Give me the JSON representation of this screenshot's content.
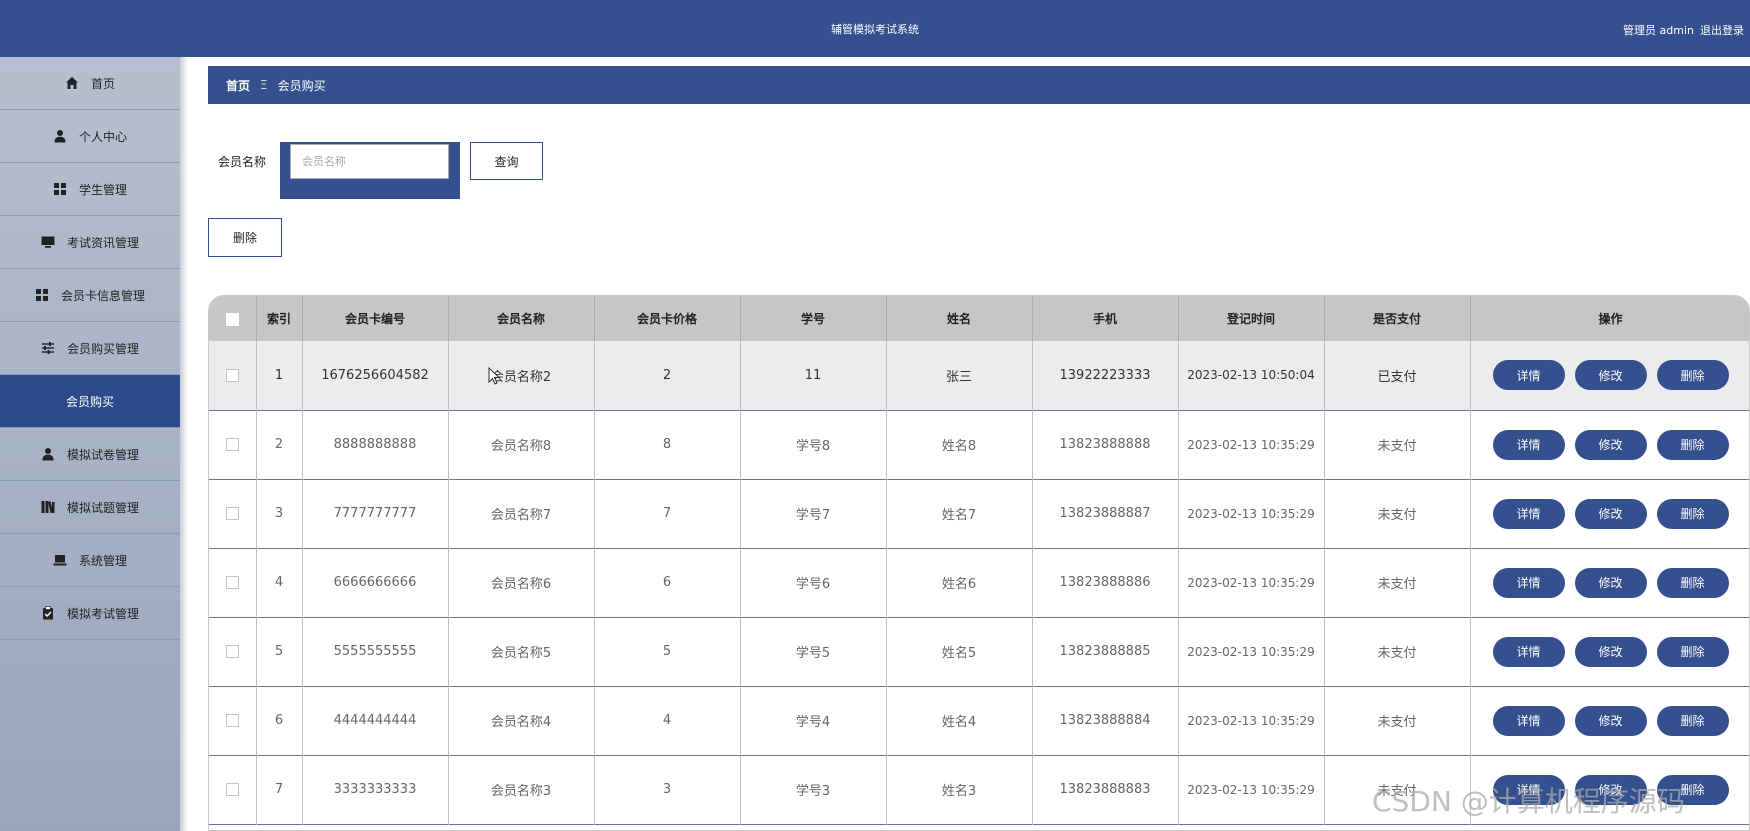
{
  "header": {
    "title": "辅管模拟考试系统",
    "user": "管理员 admin",
    "logout": "退出登录"
  },
  "sidebar": {
    "items": [
      {
        "label": "首页",
        "icon": "home-icon",
        "active": false
      },
      {
        "label": "个人中心",
        "icon": "user-icon",
        "active": false
      },
      {
        "label": "学生管理",
        "icon": "grid-icon",
        "active": false
      },
      {
        "label": "考试资讯管理",
        "icon": "monitor-icon",
        "active": false
      },
      {
        "label": "会员卡信息管理",
        "icon": "grid-icon",
        "active": false
      },
      {
        "label": "会员购买管理",
        "icon": "sliders-icon",
        "active": false
      },
      {
        "label": "会员购买",
        "icon": "",
        "active": true
      },
      {
        "label": "模拟试卷管理",
        "icon": "user-icon",
        "active": false
      },
      {
        "label": "模拟试题管理",
        "icon": "books-icon",
        "active": false
      },
      {
        "label": "系统管理",
        "icon": "laptop-icon",
        "active": false
      },
      {
        "label": "模拟考试管理",
        "icon": "clipboard-icon",
        "active": false
      }
    ]
  },
  "breadcrumb": {
    "home": "首页",
    "separator": "Ξ",
    "current": "会员购买"
  },
  "search": {
    "label": "会员名称",
    "placeholder": "会员名称",
    "value": "",
    "query_label": "查询"
  },
  "toolbar": {
    "delete_label": "删除"
  },
  "table": {
    "columns": [
      "索引",
      "会员卡编号",
      "会员名称",
      "会员卡价格",
      "学号",
      "姓名",
      "手机",
      "登记时间",
      "是否支付",
      "操作"
    ],
    "rows": [
      {
        "index": "1",
        "card_no": "1676256604582",
        "member_name": "会员名称2",
        "price": "2",
        "student_no": "11",
        "name": "张三",
        "phone": "13922223333",
        "time": "2023-02-13 10:50:04",
        "paid": "已支付"
      },
      {
        "index": "2",
        "card_no": "8888888888",
        "member_name": "会员名称8",
        "price": "8",
        "student_no": "学号8",
        "name": "姓名8",
        "phone": "13823888888",
        "time": "2023-02-13 10:35:29",
        "paid": "未支付"
      },
      {
        "index": "3",
        "card_no": "7777777777",
        "member_name": "会员名称7",
        "price": "7",
        "student_no": "学号7",
        "name": "姓名7",
        "phone": "13823888887",
        "time": "2023-02-13 10:35:29",
        "paid": "未支付"
      },
      {
        "index": "4",
        "card_no": "6666666666",
        "member_name": "会员名称6",
        "price": "6",
        "student_no": "学号6",
        "name": "姓名6",
        "phone": "13823888886",
        "time": "2023-02-13 10:35:29",
        "paid": "未支付"
      },
      {
        "index": "5",
        "card_no": "5555555555",
        "member_name": "会员名称5",
        "price": "5",
        "student_no": "学号5",
        "name": "姓名5",
        "phone": "13823888885",
        "time": "2023-02-13 10:35:29",
        "paid": "未支付"
      },
      {
        "index": "6",
        "card_no": "4444444444",
        "member_name": "会员名称4",
        "price": "4",
        "student_no": "学号4",
        "name": "姓名4",
        "phone": "13823888884",
        "time": "2023-02-13 10:35:29",
        "paid": "未支付"
      },
      {
        "index": "7",
        "card_no": "3333333333",
        "member_name": "会员名称3",
        "price": "3",
        "student_no": "学号3",
        "name": "姓名3",
        "phone": "13823888883",
        "time": "2023-02-13 10:35:29",
        "paid": "未支付"
      }
    ],
    "actions": {
      "detail": "详情",
      "edit": "修改",
      "delete": "删除"
    }
  },
  "watermark": "CSDN @计算机程序源码",
  "colors": {
    "primary": "#34508f",
    "active_menu": "#2c4a8c",
    "header_row": "#c6c6c6"
  }
}
